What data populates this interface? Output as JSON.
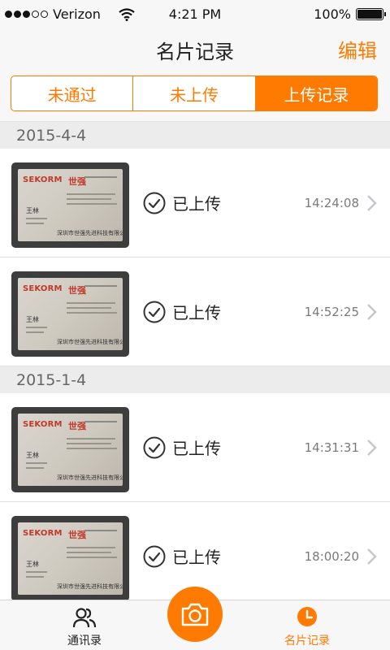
{
  "status_bar": {
    "carrier": "Verizon",
    "time": "4:21 PM",
    "battery": "100%"
  },
  "nav": {
    "title": "名片记录",
    "edit_label": "编辑"
  },
  "segments": [
    {
      "label": "未通过",
      "active": false
    },
    {
      "label": "未上传",
      "active": false
    },
    {
      "label": "上传记录",
      "active": true
    }
  ],
  "sections": [
    {
      "date": "2015-4-4",
      "items": [
        {
          "status": "已上传",
          "time": "14:24:08",
          "card_brand": "SEKORM",
          "card_brand_cn": "世强",
          "card_name": "王林",
          "card_company": "深圳市世强先进科技有限公司"
        },
        {
          "status": "已上传",
          "time": "14:52:25",
          "card_brand": "SEKORM",
          "card_brand_cn": "世强",
          "card_name": "王林",
          "card_company": "深圳市世强先进科技有限公司"
        }
      ]
    },
    {
      "date": "2015-1-4",
      "items": [
        {
          "status": "已上传",
          "time": "14:31:31",
          "card_brand": "SEKORM",
          "card_brand_cn": "世强",
          "card_name": "王林",
          "card_company": "深圳市世强先进科技有限公司"
        },
        {
          "status": "已上传",
          "time": "18:00:20",
          "card_brand": "SEKORM",
          "card_brand_cn": "世强",
          "card_name": "王林",
          "card_company": "深圳市世强先进科技有限公司"
        }
      ]
    }
  ],
  "tabs": {
    "contacts_label": "通讯录",
    "records_label": "名片记录"
  },
  "colors": {
    "accent": "#ff7a00",
    "section_bg": "#ececec"
  }
}
